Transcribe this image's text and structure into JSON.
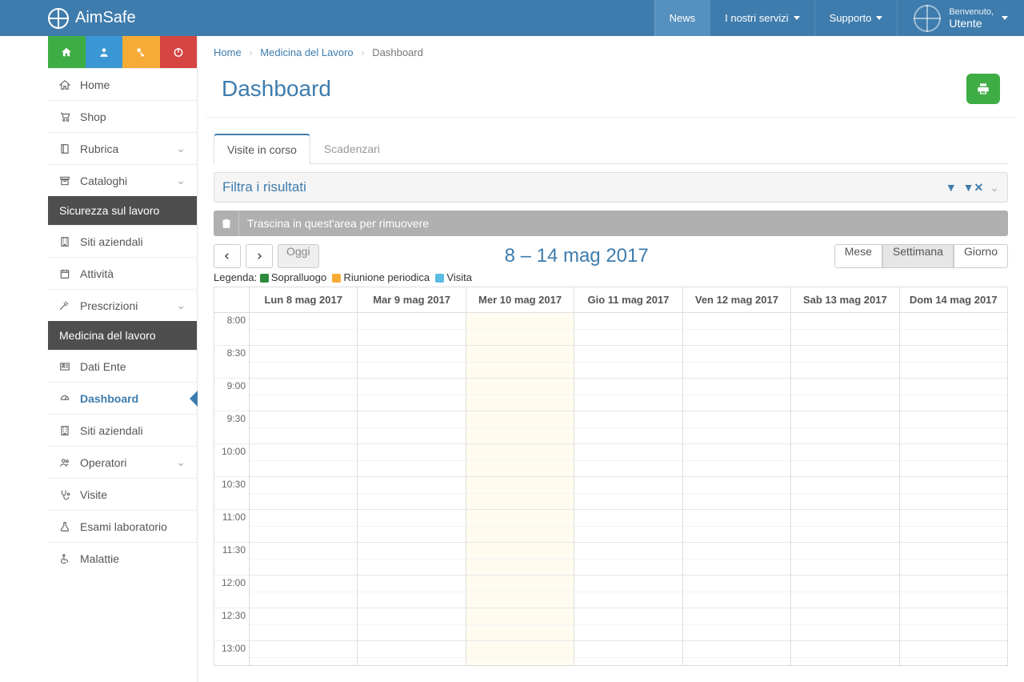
{
  "brand": "AimSafe",
  "topnav": {
    "news": "News",
    "servizi": "I nostri servizi",
    "supporto": "Supporto",
    "welcome_small": "Benvenuto,",
    "welcome_user": "Utente"
  },
  "sidebar": {
    "items": [
      {
        "label": "Home",
        "icon": "home"
      },
      {
        "label": "Shop",
        "icon": "cart"
      },
      {
        "label": "Rubrica",
        "icon": "book",
        "expandable": true
      },
      {
        "label": "Cataloghi",
        "icon": "archive",
        "expandable": true
      }
    ],
    "section1_title": "Sicurezza sul lavoro",
    "section1": [
      {
        "label": "Siti aziendali",
        "icon": "building"
      },
      {
        "label": "Attività",
        "icon": "calendar"
      },
      {
        "label": "Prescrizioni",
        "icon": "gavel",
        "expandable": true
      }
    ],
    "section2_title": "Medicina del lavoro",
    "section2": [
      {
        "label": "Dati Ente",
        "icon": "idcard"
      },
      {
        "label": "Dashboard",
        "icon": "dashboard",
        "active": true
      },
      {
        "label": "Siti aziendali",
        "icon": "building"
      },
      {
        "label": "Operatori",
        "icon": "users",
        "expandable": true
      },
      {
        "label": "Visite",
        "icon": "steth"
      },
      {
        "label": "Esami laboratorio",
        "icon": "flask"
      },
      {
        "label": "Malattie",
        "icon": "wheelchair"
      }
    ]
  },
  "breadcrumb": {
    "home": "Home",
    "mid": "Medicina del Lavoro",
    "current": "Dashboard"
  },
  "page_title": "Dashboard",
  "tabs": {
    "visite": "Visite in corso",
    "scad": "Scadenzari"
  },
  "filter_title": "Filtra i risultati",
  "remove_text": "Trascina in quest'area per rimuovere",
  "calendar": {
    "today_btn": "Oggi",
    "title": "8 – 14 mag 2017",
    "views": {
      "month": "Mese",
      "week": "Settimana",
      "day": "Giorno"
    },
    "legend": {
      "label": "Legenda:",
      "sopra": "Sopralluogo",
      "riun": "Riunione periodica",
      "vis": "Visita"
    },
    "colors": {
      "sopra": "#2e8b3d",
      "riun": "#f5ab35",
      "vis": "#5bbce4"
    },
    "days": [
      "Lun 8 mag 2017",
      "Mar 9 mag 2017",
      "Mer 10 mag 2017",
      "Gio 11 mag 2017",
      "Ven 12 mag 2017",
      "Sab 13 mag 2017",
      "Dom 14 mag 2017"
    ],
    "today_index": 2,
    "times": [
      "8:00",
      "8:30",
      "9:00",
      "9:30",
      "10:00",
      "10:30",
      "11:00",
      "11:30",
      "12:00",
      "12:30",
      "13:00"
    ]
  }
}
